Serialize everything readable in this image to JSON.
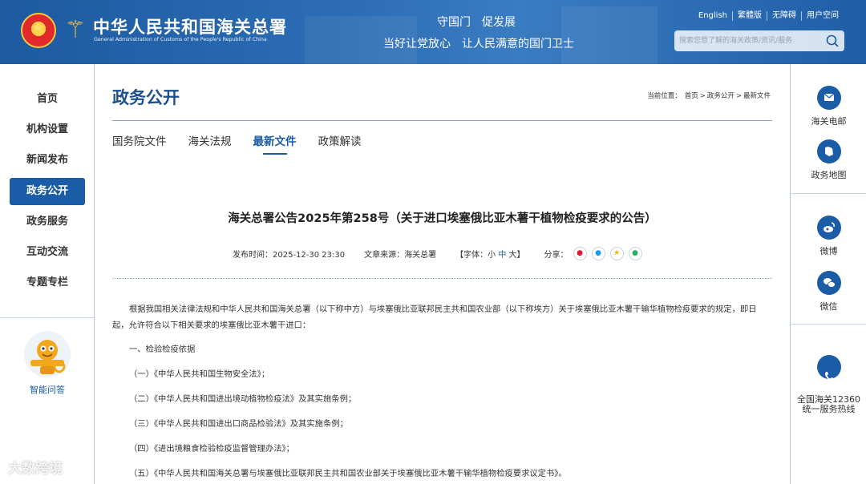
{
  "header": {
    "site_title": "中华人民共和国海关总署",
    "site_subtitle": "General Administration of Customs of the People's Republic of China",
    "slogan_1": "守国门　促发展",
    "slogan_2": "当好让党放心　让人民满意的国门卫士",
    "links": [
      "English",
      "繁體版",
      "无障碍",
      "用户空间"
    ],
    "search_placeholder": "搜索您想了解的海关政策/资讯/服务"
  },
  "left_nav": {
    "items": [
      "首页",
      "机构设置",
      "新闻发布",
      "政务公开",
      "政务服务",
      "互动交流",
      "专题专栏"
    ],
    "active": "政务公开",
    "assistant_label": "智能问答"
  },
  "right_bar": {
    "items": [
      "海关电邮",
      "政务地图",
      "微博",
      "微信",
      "全国海关12360\n统一服务热线"
    ]
  },
  "section": {
    "title": "政务公开",
    "breadcrumb_prefix": "当前位置：",
    "breadcrumb": [
      "首页",
      "政务公开",
      "最新文件"
    ],
    "tabs": [
      "国务院文件",
      "海关法规",
      "最新文件",
      "政策解读"
    ],
    "active_tab": "最新文件"
  },
  "article": {
    "title": "海关总署公告2025年第258号（关于进口埃塞俄比亚木薯干植物检疫要求的公告）",
    "publish_label": "发布时间：",
    "publish_time": "2025-12-30 23:30",
    "source_label": "文章来源：",
    "source": "海关总署",
    "font_label_open": "【字体：",
    "font_small": "小",
    "font_medium": "中",
    "font_large": "大",
    "font_label_close": "】",
    "share_label": "分享：",
    "intro": "根据我国相关法律法规和中华人民共和国海关总署（以下称中方）与埃塞俄比亚联邦民主共和国农业部（以下称埃方）关于埃塞俄比亚木薯干输华植物检疫要求的规定，即日起，允许符合以下相关要求的埃塞俄比亚木薯干进口：",
    "paragraphs": [
      "一、检验检疫依据",
      "（一）《中华人民共和国生物安全法》；",
      "（二）《中华人民共和国进出境动植物检疫法》及其实施条例；",
      "（三）《中华人民共和国进出口商品检验法》及其实施条例；",
      "（四）《进出境粮食检验检疫监督管理办法》；",
      "（五）《中华人民共和国海关总署与埃塞俄比亚联邦民主共和国农业部关于埃塞俄比亚木薯干输华植物检疫要求议定书》。"
    ]
  },
  "watermark": "大数跨境",
  "colors": {
    "brand_blue": "#1a5ca6",
    "header_blue": "#2c6db5"
  }
}
